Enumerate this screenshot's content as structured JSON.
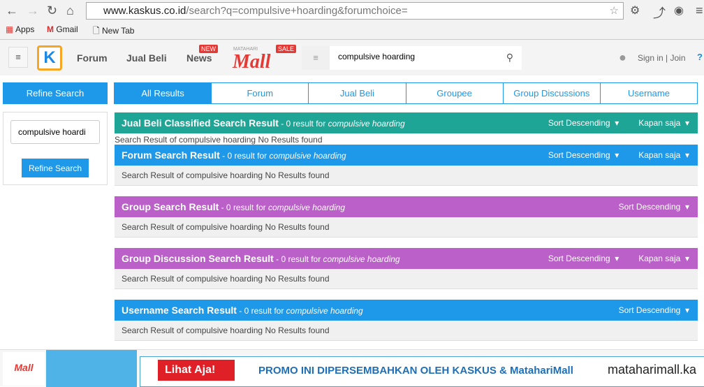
{
  "browser": {
    "url_host": "www.kaskus.co.id",
    "url_path": "/search?q=compulsive+hoarding&forumchoice=",
    "bookmarks": [
      "Apps",
      "Gmail",
      "New Tab"
    ]
  },
  "header": {
    "nav": [
      "Forum",
      "Jual Beli",
      "News"
    ],
    "news_badge": "NEW",
    "mall_text": "Mall",
    "mall_top": "MATAHARI",
    "sale_badge": "SALE",
    "search_value": "compulsive hoarding",
    "signin": "Sign in | Join"
  },
  "sidebar": {
    "title": "Refine Search",
    "input_value": "compulsive hoardi",
    "button": "Refine Search"
  },
  "tabs": [
    "All Results",
    "Forum",
    "Jual Beli",
    "Groupee",
    "Group Discussions",
    "Username"
  ],
  "sections": [
    {
      "title": "Jual Beli Classified Search Result",
      "sub": " - 0 result for ",
      "query": "compulsive hoarding",
      "controls": [
        "Sort Descending",
        "Kapan saja"
      ],
      "color": "#1fa595",
      "body": "Search Result of compulsive hoarding No Results found"
    },
    {
      "title": "Forum Search Result",
      "sub": " - 0 result for ",
      "query": "compulsive hoarding",
      "controls": [
        "Sort Descending",
        "Kapan saja"
      ],
      "color": "#1e98e8",
      "body": "Search Result of compulsive hoarding No Results found"
    },
    {
      "title": "Group Search Result",
      "sub": " - 0 result for ",
      "query": "compulsive hoarding",
      "controls": [
        "Sort Descending"
      ],
      "color": "#bb5fc9",
      "body": "Search Result of compulsive hoarding No Results found"
    },
    {
      "title": "Group Discussion Search Result",
      "sub": " - 0 result for ",
      "query": "compulsive hoarding",
      "controls": [
        "Sort Descending",
        "Kapan saja"
      ],
      "color": "#bb5fc9",
      "body": "Search Result of compulsive hoarding No Results found"
    },
    {
      "title": "Username Search Result",
      "sub": " - 0 result for ",
      "query": "compulsive hoarding",
      "controls": [
        "Sort Descending"
      ],
      "color": "#1e98e8",
      "body": "Search Result of compulsive hoarding No Results found"
    }
  ],
  "banner": {
    "cta": "Lihat Aja!",
    "promo": "PROMO INI DIPERSEMBAHKAN OLEH KASKUS & MatahariMall",
    "site": "mataharimall.ka"
  }
}
